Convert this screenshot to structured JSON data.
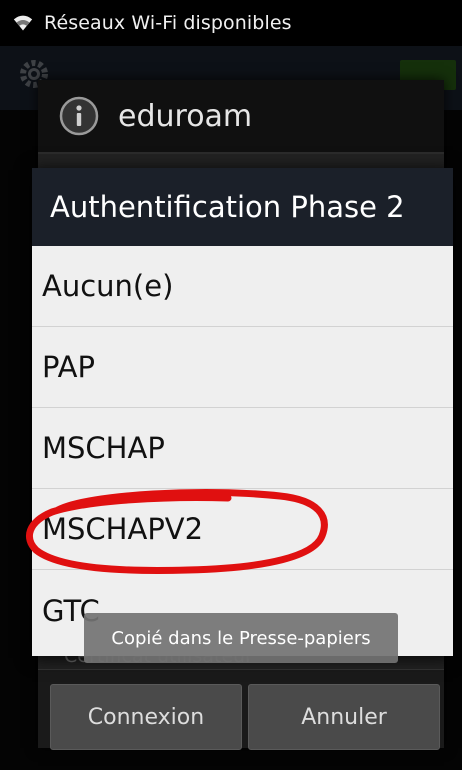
{
  "status_bar": {
    "title": "Réseaux Wi-Fi disponibles",
    "icon": "wifi-icon"
  },
  "background": {
    "icons": [
      "gear-icon"
    ]
  },
  "back_dialog": {
    "ssid": "eduroam",
    "icon": "info-icon",
    "field_hint": "Certificat utilisateur",
    "buttons": {
      "connect": "Connexion",
      "cancel": "Annuler"
    }
  },
  "phase2_dialog": {
    "title": "Authentification Phase 2",
    "options": [
      "Aucun(e)",
      "PAP",
      "MSCHAP",
      "MSCHAPV2",
      "GTC"
    ],
    "highlighted_option": "MSCHAPV2"
  },
  "toast": {
    "message": "Copié dans le Presse-papiers"
  },
  "colors": {
    "annotation": "#e01010",
    "dialog_title_bg": "#1b2029"
  }
}
